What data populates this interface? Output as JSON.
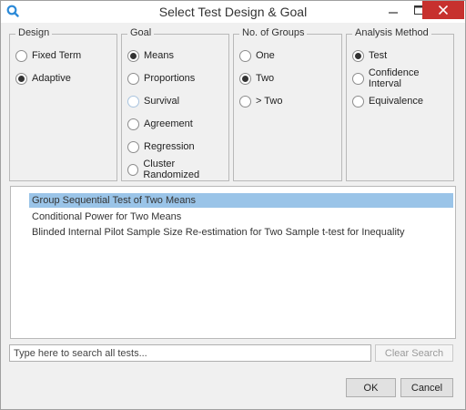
{
  "window": {
    "title": "Select Test Design & Goal"
  },
  "design": {
    "title": "Design",
    "options": [
      {
        "label": "Fixed Term",
        "selected": false
      },
      {
        "label": "Adaptive",
        "selected": true
      }
    ]
  },
  "goal": {
    "title": "Goal",
    "options": [
      {
        "label": "Means",
        "selected": true
      },
      {
        "label": "Proportions",
        "selected": false
      },
      {
        "label": "Survival",
        "selected": false
      },
      {
        "label": "Agreement",
        "selected": false
      },
      {
        "label": "Regression",
        "selected": false
      },
      {
        "label": "Cluster Randomized",
        "selected": false
      }
    ]
  },
  "groups": {
    "title": "No. of Groups",
    "options": [
      {
        "label": "One",
        "selected": false
      },
      {
        "label": "Two",
        "selected": true
      },
      {
        "label": "> Two",
        "selected": false
      }
    ]
  },
  "analysis": {
    "title": "Analysis Method",
    "options": [
      {
        "label": "Test",
        "selected": true
      },
      {
        "label": "Confidence Interval",
        "selected": false
      },
      {
        "label": "Equivalence",
        "selected": false
      }
    ]
  },
  "tests": {
    "items": [
      "Group Sequential Test of Two Means",
      "Conditional Power for Two Means",
      "Blinded Internal Pilot Sample Size Re-estimation for Two Sample t-test for Inequality"
    ],
    "selected_index": 0
  },
  "search": {
    "placeholder": "Type here to search all tests...",
    "value": ""
  },
  "buttons": {
    "clear_search": "Clear Search",
    "ok": "OK",
    "cancel": "Cancel"
  },
  "colors": {
    "selection": "#9ac4e8",
    "close_button": "#c7312e",
    "app_icon": "#2c8ad8"
  }
}
